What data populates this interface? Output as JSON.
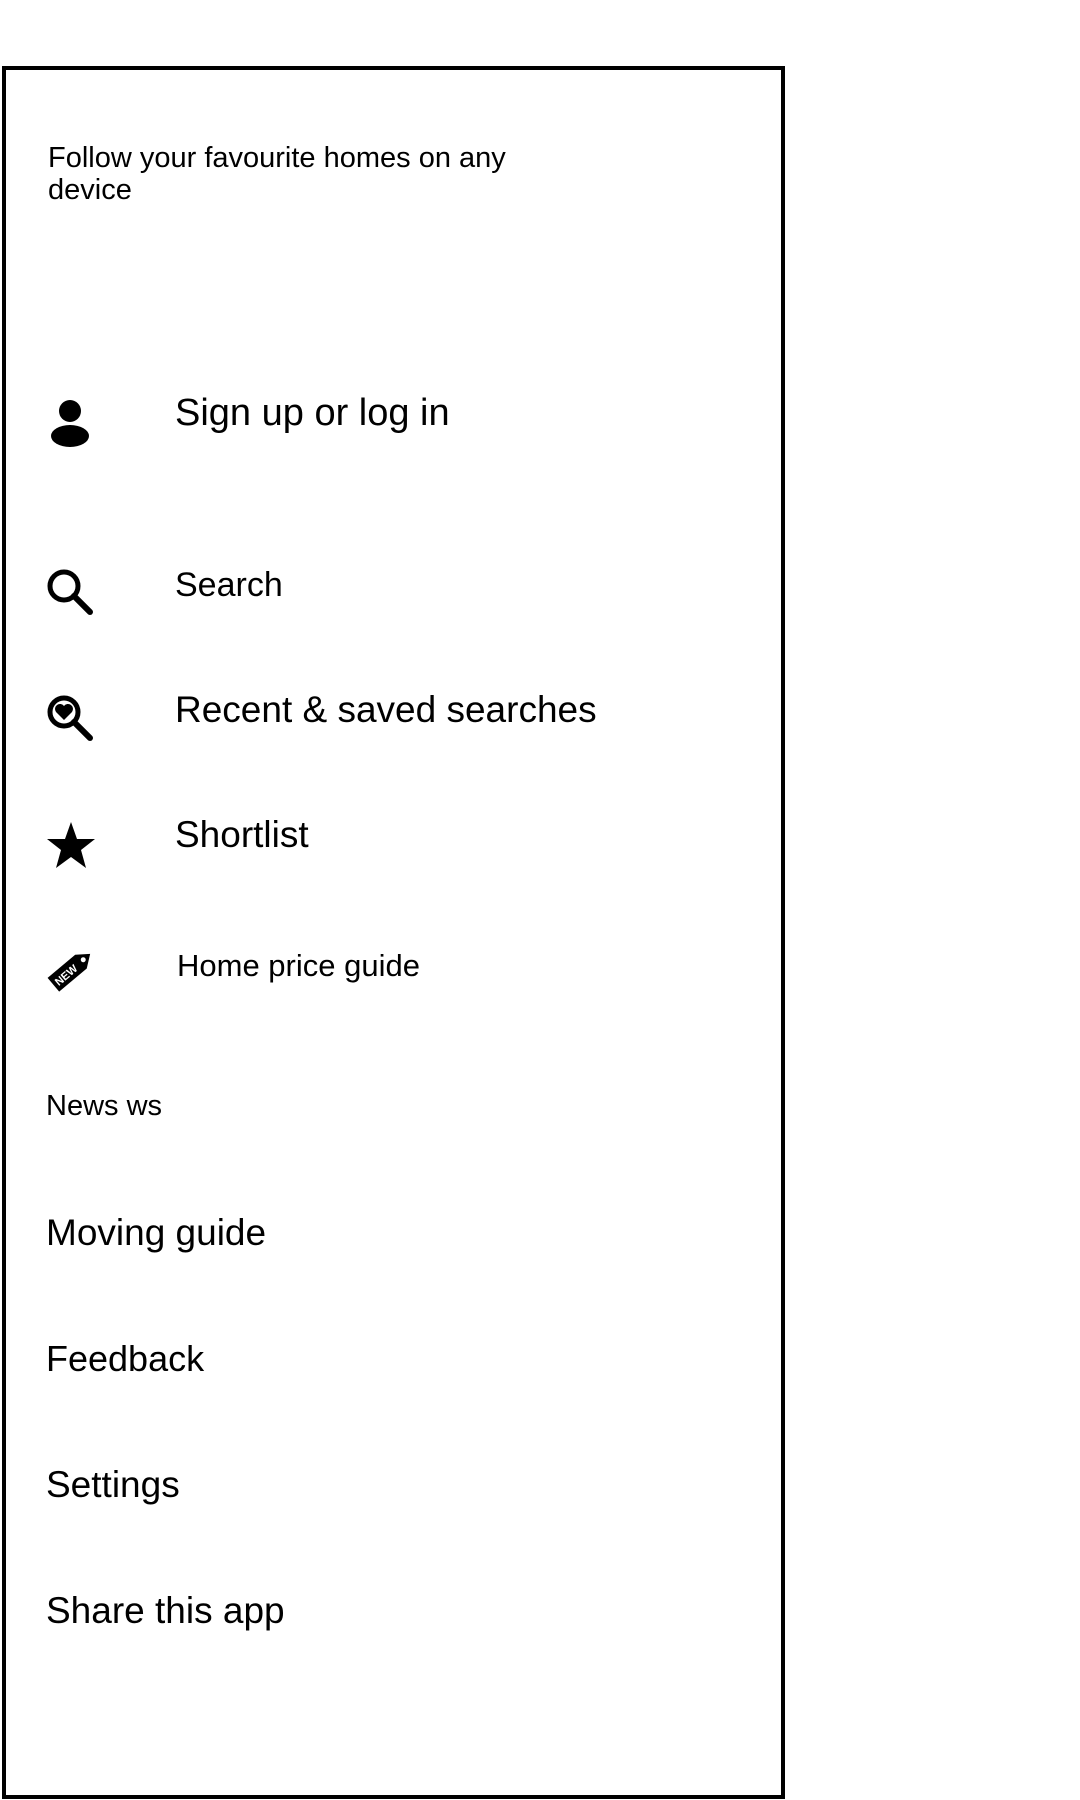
{
  "drawer": {
    "tagline": "Follow your favourite homes on any device",
    "account_item": {
      "label": "Sign up or log in",
      "icon": "person-icon"
    },
    "main_items": [
      {
        "label": "Search",
        "icon": "search-icon"
      },
      {
        "label": "Recent & saved searches",
        "icon": "heart-search-icon"
      },
      {
        "label": "Shortlist",
        "icon": "star-icon"
      },
      {
        "label": "Home price guide",
        "icon": "new-tag-icon",
        "icon_text": "NEW"
      }
    ],
    "secondary_items": [
      {
        "label": "News ws"
      },
      {
        "label": "Moving guide"
      },
      {
        "label": "Feedback"
      },
      {
        "label": "Settings"
      },
      {
        "label": "Share this app"
      }
    ]
  },
  "colors": {
    "foreground": "#000000",
    "background": "#ffffff"
  }
}
